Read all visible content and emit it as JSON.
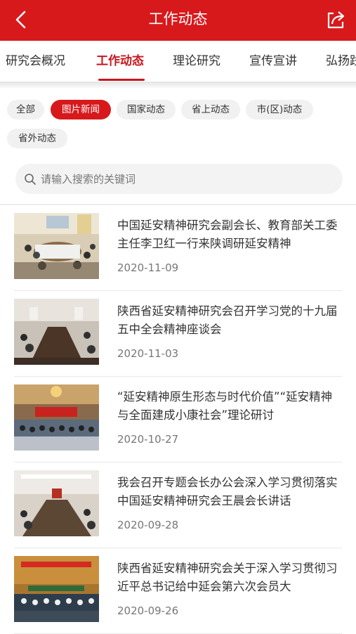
{
  "header": {
    "title": "工作动态",
    "back_icon": "chevron-left-icon",
    "share_icon": "share-icon",
    "color": "#d8191c"
  },
  "tabs": [
    {
      "label": "研究会概况",
      "active": false
    },
    {
      "label": "工作动态",
      "active": true
    },
    {
      "label": "理论研究",
      "active": false
    },
    {
      "label": "宣传宣讲",
      "active": false
    },
    {
      "label": "弘扬践",
      "active": false
    }
  ],
  "filters": [
    {
      "label": "全部",
      "active": false
    },
    {
      "label": "图片新闻",
      "active": true
    },
    {
      "label": "国家动态",
      "active": false
    },
    {
      "label": "省上动态",
      "active": false
    },
    {
      "label": "市(区)动态",
      "active": false
    },
    {
      "label": "省外动态",
      "active": false
    }
  ],
  "search": {
    "placeholder": "请输入搜索的关键词"
  },
  "news": [
    {
      "title": "中国延安精神研究会副会长、教育部关工委主任李卫红一行来陕调研延安精神",
      "date": "2020-11-09"
    },
    {
      "title": "陕西省延安精神研究会召开学习党的十九届五中全会精神座谈会",
      "date": "2020-11-03"
    },
    {
      "title": "“延安精神原生形态与时代价值”“延安精神与全面建成小康社会”理论研讨",
      "date": "2020-10-27"
    },
    {
      "title": "我会召开专题会长办公会深入学习贯彻落实中国延安精神研究会王晨会长讲话",
      "date": "2020-09-28"
    },
    {
      "title": "陕西省延安精神研究会关于深入学习贯彻习近平总书记给中延会第六次会员大",
      "date": "2020-09-26"
    }
  ]
}
